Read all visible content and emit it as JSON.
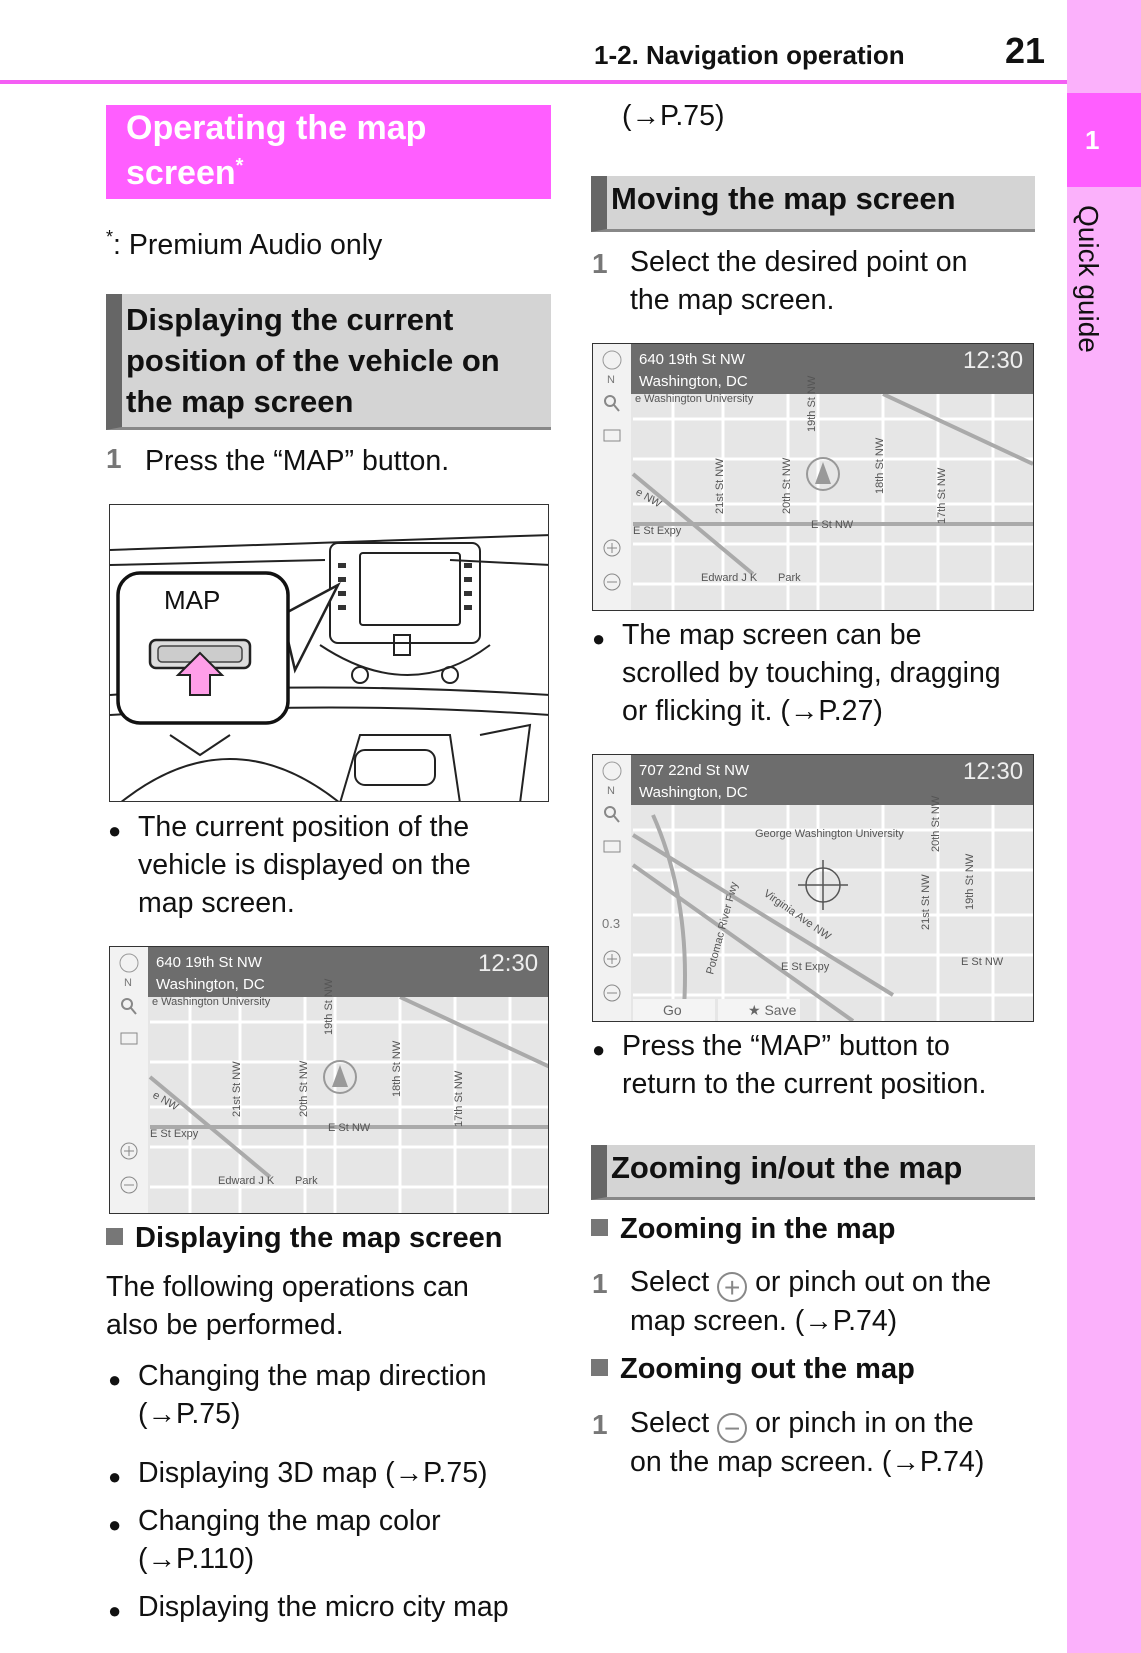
{
  "header": {
    "section": "1-2. Navigation operation",
    "page_number": "21"
  },
  "side_tab": {
    "number": "1",
    "label": "Quick guide"
  },
  "colors": {
    "accent": "#ff5eff",
    "side": "#fbb1fb",
    "heading_bg": "#d4d4d4"
  },
  "left": {
    "title_line1": "Operating the map",
    "title_line2": "screen",
    "title_mark": "*",
    "footnote_mark": "*",
    "footnote": ": Premium Audio only",
    "heading1": [
      "Displaying the current",
      "position of the vehicle on",
      "the map screen"
    ],
    "step1_num": "1",
    "step1": "Press the “MAP” button.",
    "illustration_label": "MAP",
    "bullet1": [
      "The current position of the",
      "vehicle is displayed on the",
      "map screen."
    ],
    "sub1": "Displaying the map screen",
    "para": [
      "The following operations can",
      "also be performed."
    ],
    "bullets": [
      [
        "Changing the map direction",
        "(→P.75)"
      ],
      [
        "Displaying 3D map (→P.75)"
      ],
      [
        "Changing the map color",
        "(→P.110)"
      ],
      [
        "Displaying the micro city map"
      ]
    ]
  },
  "right": {
    "cont": "(→P.75)",
    "heading2": "Moving the map screen",
    "step_num": "1",
    "step1": [
      "Select the desired point on",
      "the map screen."
    ],
    "bullet1": [
      "The map screen can be",
      "scrolled by touching, dragging",
      "or flicking it. (→P.27)"
    ],
    "bullet2": [
      "Press the “MAP” button to",
      "return to the current position."
    ],
    "heading3": "Zooming in/out the map",
    "sub_in": "Zooming in the map",
    "step_in_a": "Select",
    "step_in_b": "or pinch out on the",
    "step_in_c": "map screen. (→P.74)",
    "sub_out": "Zooming out the map",
    "step_out_a": "Select",
    "step_out_b": "or pinch in on the",
    "step_out_c": "on the map screen. (→P.74)",
    "plus_icon": "+",
    "minus_icon": "−"
  },
  "maps": [
    {
      "address": "640 19th St NW",
      "city": "Washington, DC",
      "time": "12:30",
      "north": "N",
      "labels": [
        "e Washington University",
        "21st St NW",
        "20th St NW",
        "19th St NW",
        "18th St NW",
        "17th St NW",
        "e NW",
        "E St Expy",
        "E St NW",
        "Edward J K",
        "Park"
      ]
    },
    {
      "address": "640 19th St NW",
      "city": "Washington, DC",
      "time": "12:30",
      "north": "N",
      "labels": [
        "e Washington University",
        "21st St NW",
        "20th St NW",
        "19th St NW",
        "18th St NW",
        "17th St NW",
        "e NW",
        "E St Expy",
        "E St NW",
        "Edward J K",
        "Park"
      ]
    },
    {
      "address": "707 22nd St NW",
      "city": "Washington, DC",
      "time": "12:30",
      "north": "N",
      "scale": "0.3",
      "labels": [
        "George Washington University",
        "21st St NW",
        "20th St NW",
        "19th St NW",
        "Virginia Ave NW",
        "Potomac River Fwy",
        "E St Expy",
        "E St NW"
      ],
      "buttons": [
        "Go",
        "★ Save"
      ]
    }
  ]
}
